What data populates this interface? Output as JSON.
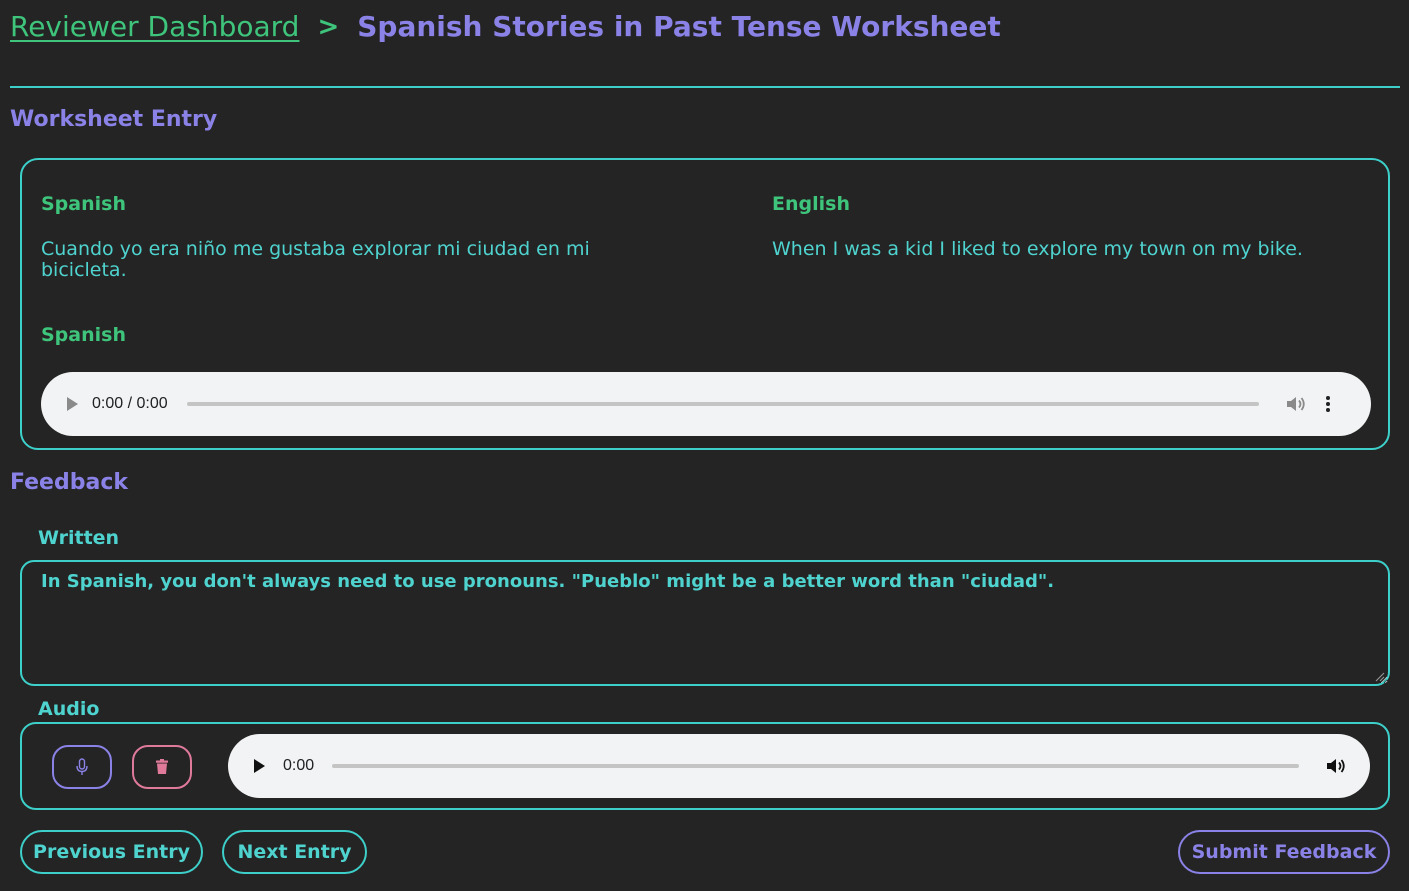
{
  "breadcrumb": {
    "parent": "Reviewer Dashboard",
    "separator": ">",
    "current": "Spanish Stories in Past Tense Worksheet"
  },
  "worksheet_entry": {
    "title": "Worksheet Entry",
    "spanish_label": "Spanish",
    "spanish_text": "Cuando yo era niño me gustaba explorar mi ciudad en mi bicicleta.",
    "english_label": "English",
    "english_text": "When I was a kid I liked to explore my town on my bike.",
    "audio_label": "Spanish",
    "audio_player": {
      "time": "0:00 / 0:00",
      "icons": [
        "play-icon",
        "volume-icon",
        "more-vert-icon"
      ]
    }
  },
  "feedback": {
    "title": "Feedback",
    "written_label": "Written",
    "written_text": "In Spanish, you don't always need to use pronouns. \"Pueblo\" might be a better word than \"ciudad\".",
    "audio_label": "Audio",
    "record_icon": "microphone-icon",
    "delete_icon": "trash-icon",
    "audio_player": {
      "time": "0:00",
      "icons": [
        "play-icon",
        "volume-icon"
      ]
    }
  },
  "actions": {
    "previous_label": "Previous Entry",
    "next_label": "Next Entry",
    "submit_label": "Submit Feedback"
  },
  "colors": {
    "background": "#242424",
    "green": "#3ec47b",
    "purple": "#8a82e6",
    "teal": "#3dcfc9",
    "pink": "#e07a9b",
    "player_bg": "#f1f3f4"
  }
}
